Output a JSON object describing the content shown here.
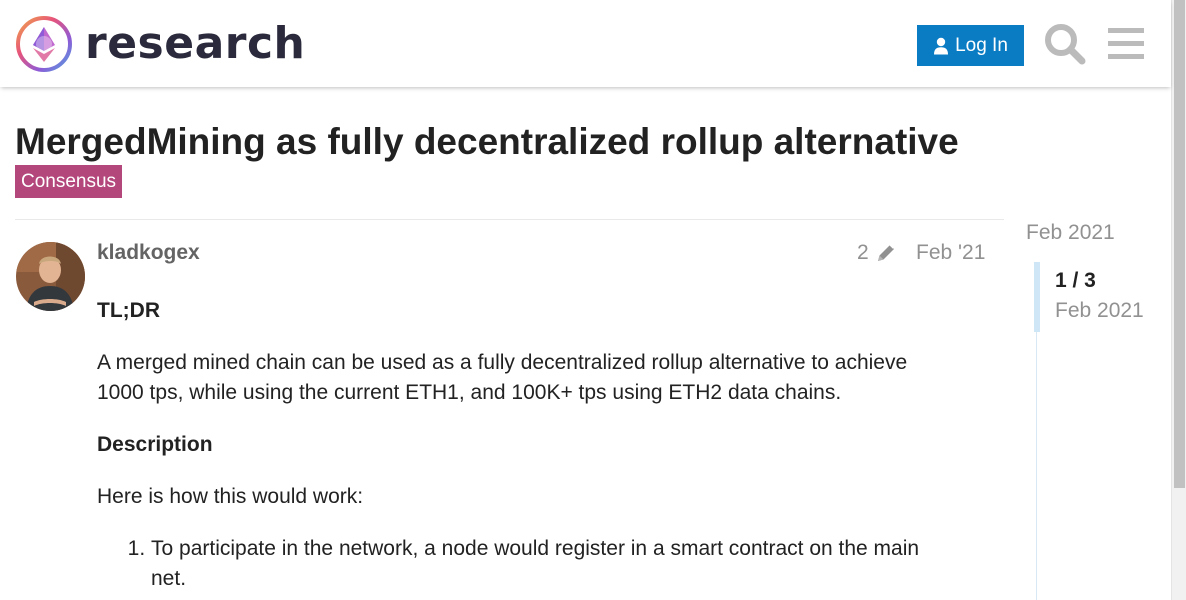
{
  "header": {
    "logo_text": "research",
    "login_label": "Log In"
  },
  "topic": {
    "title": "MergedMining as fully decentralized rollup alternative",
    "category": "Consensus",
    "category_color": "#b3467b"
  },
  "post": {
    "username": "kladkogex",
    "edit_count": "2",
    "date": "Feb '21",
    "tldr_heading": "TL;DR",
    "summary": "A merged mined chain can be used as a fully decentralized rollup alternative to achieve 1000 tps, while using the current ETH1, and 100K+ tps using ETH2 data chains.",
    "description_heading": "Description",
    "intro": "Here is how this would work:",
    "steps": [
      "To participate in the network, a node would register in a smart contract on the main net."
    ]
  },
  "timeline": {
    "top_date": "Feb 2021",
    "position": "1 / 3",
    "current_date": "Feb 2021"
  },
  "colors": {
    "login_button": "#0a7cc4",
    "muted_text": "#919191"
  }
}
